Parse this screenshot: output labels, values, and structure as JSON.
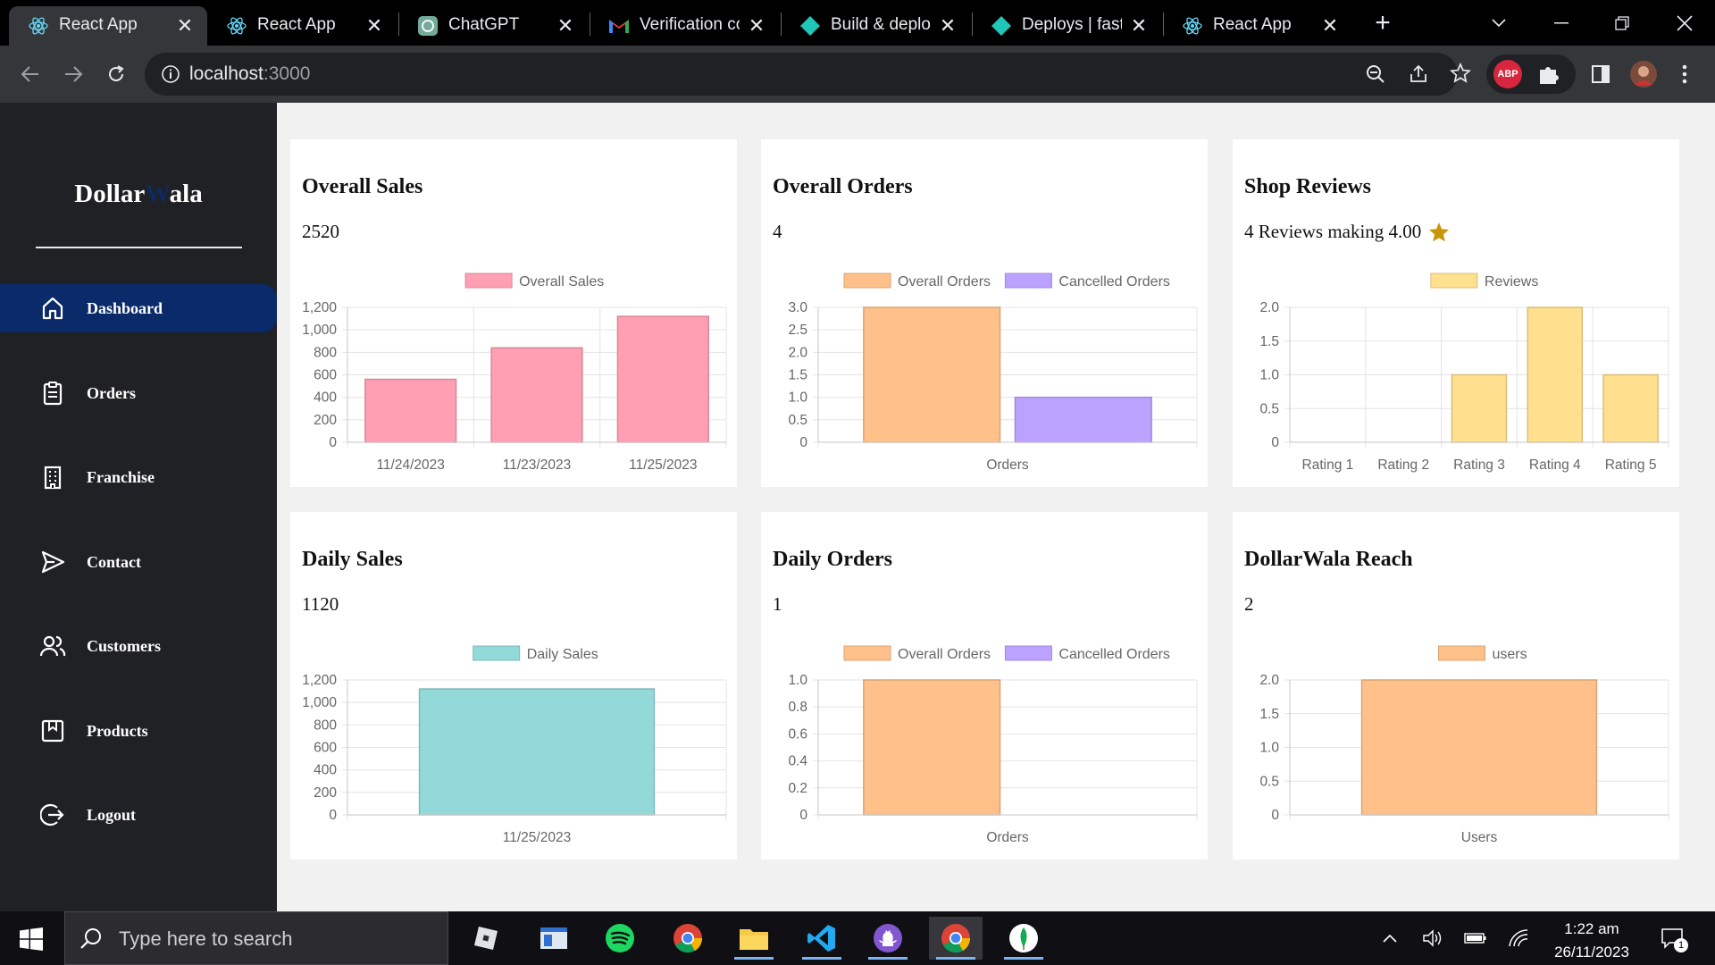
{
  "browser": {
    "tabs": [
      {
        "title": "React App",
        "icon": "react-icon"
      },
      {
        "title": "React App",
        "icon": "react-icon"
      },
      {
        "title": "ChatGPT",
        "icon": "chatgpt-icon"
      },
      {
        "title": "Verification co",
        "icon": "gmail-icon"
      },
      {
        "title": "Build & deplo",
        "icon": "netlify-icon"
      },
      {
        "title": "Deploys | fasti",
        "icon": "netlify-icon"
      },
      {
        "title": "React App",
        "icon": "react-icon"
      }
    ],
    "url_host": "localhost",
    "url_port": ":3000",
    "extension_badge": "ABP"
  },
  "sidebar": {
    "brand_part1": "Dollar",
    "brand_part2": "W",
    "brand_part3": "ala",
    "items": [
      {
        "label": "Dashboard",
        "icon": "home-icon"
      },
      {
        "label": "Orders",
        "icon": "clipboard-icon"
      },
      {
        "label": "Franchise",
        "icon": "building-icon"
      },
      {
        "label": "Contact",
        "icon": "send-icon"
      },
      {
        "label": "Customers",
        "icon": "users-icon"
      },
      {
        "label": "Products",
        "icon": "bookmark-icon"
      },
      {
        "label": "Logout",
        "icon": "logout-icon"
      }
    ]
  },
  "cards": [
    {
      "title": "Overall Sales",
      "value": "2520"
    },
    {
      "title": "Overall Orders",
      "value": "4"
    },
    {
      "title": "Shop Reviews",
      "value": "4 Reviews making 4.00"
    },
    {
      "title": "Daily Sales",
      "value": "1120"
    },
    {
      "title": "Daily Orders",
      "value": "1"
    },
    {
      "title": "DollarWala Reach",
      "value": "2"
    }
  ],
  "chart_data": [
    {
      "type": "bar",
      "categories": [
        "11/24/2023",
        "11/23/2023",
        "11/25/2023"
      ],
      "series": [
        {
          "name": "Overall Sales",
          "values": [
            560,
            840,
            1120
          ],
          "color": "#ff9fb4"
        }
      ],
      "yticks": [
        "0",
        "200",
        "400",
        "600",
        "800",
        "1,000",
        "1,200"
      ],
      "ylim": [
        0,
        1200
      ],
      "grouped": false,
      "legend_position": "top"
    },
    {
      "type": "bar",
      "categories": [
        "Orders"
      ],
      "series": [
        {
          "name": "Overall Orders",
          "values": [
            3
          ],
          "color": "#ffc08a"
        },
        {
          "name": "Cancelled Orders",
          "values": [
            1
          ],
          "color": "#bba2ff"
        }
      ],
      "yticks": [
        "0",
        "0.5",
        "1.0",
        "1.5",
        "2.0",
        "2.5",
        "3.0"
      ],
      "ylim": [
        0,
        3
      ],
      "grouped": true,
      "legend_position": "top"
    },
    {
      "type": "bar",
      "categories": [
        "Rating 1",
        "Rating 2",
        "Rating 3",
        "Rating 4",
        "Rating 5"
      ],
      "series": [
        {
          "name": "Reviews",
          "values": [
            0,
            0,
            1,
            2,
            1
          ],
          "color": "#ffe08e"
        }
      ],
      "yticks": [
        "0",
        "0.5",
        "1.0",
        "1.5",
        "2.0"
      ],
      "ylim": [
        0,
        2
      ],
      "grouped": false,
      "legend_position": "top"
    },
    {
      "type": "bar",
      "categories": [
        "11/25/2023"
      ],
      "series": [
        {
          "name": "Daily Sales",
          "values": [
            1120
          ],
          "color": "#94d9d9"
        }
      ],
      "yticks": [
        "0",
        "200",
        "400",
        "600",
        "800",
        "1,000",
        "1,200"
      ],
      "ylim": [
        0,
        1200
      ],
      "grouped": false,
      "legend_position": "top"
    },
    {
      "type": "bar",
      "categories": [
        "Orders"
      ],
      "series": [
        {
          "name": "Overall Orders",
          "values": [
            1
          ],
          "color": "#ffc08a"
        },
        {
          "name": "Cancelled Orders",
          "values": [
            0
          ],
          "color": "#bba2ff"
        }
      ],
      "yticks": [
        "0",
        "0.2",
        "0.4",
        "0.6",
        "0.8",
        "1.0"
      ],
      "ylim": [
        0,
        1
      ],
      "grouped": true,
      "legend_position": "top"
    },
    {
      "type": "bar",
      "categories": [
        "Users"
      ],
      "series": [
        {
          "name": "users",
          "values": [
            2
          ],
          "color": "#ffc08a"
        }
      ],
      "yticks": [
        "0",
        "0.5",
        "1.0",
        "1.5",
        "2.0"
      ],
      "ylim": [
        0,
        2
      ],
      "grouped": false,
      "legend_position": "top"
    }
  ],
  "taskbar": {
    "search_placeholder": "Type here to search",
    "time": "1:22 am",
    "date": "26/11/2023",
    "notification_count": "1",
    "apps": [
      "roblox-icon",
      "file-explorer-icon",
      "spotify-icon",
      "chrome-icon",
      "folder-icon",
      "vscode-icon",
      "github-icon",
      "chrome-icon",
      "mongodb-icon"
    ]
  },
  "colors": {
    "sidebar_bg": "#202124",
    "active_nav": "#0a2a6a",
    "star": "#c8960c"
  }
}
